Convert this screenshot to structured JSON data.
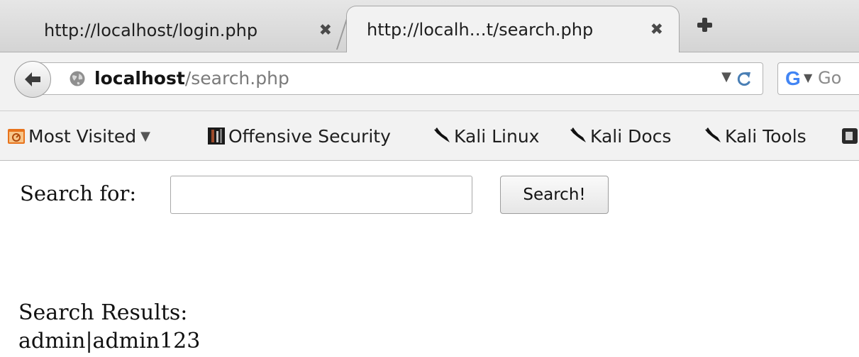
{
  "tabs": [
    {
      "title": "http://localhost/login.php",
      "close": "✖",
      "active": false
    },
    {
      "title": "http://localh…t/search.php",
      "close": "✖",
      "active": true
    }
  ],
  "navbar": {
    "url_host": "localhost",
    "url_path": "/search.php",
    "url_dropdown": "▼",
    "search_engine_letter": "G",
    "search_engine_dropdown": "▼",
    "search_placeholder": "Go"
  },
  "bookmarks": [
    {
      "label": "Most Visited",
      "caret": "▼",
      "icon": "most-visited-folder-icon"
    },
    {
      "label": "Offensive Security",
      "icon": "offensive-security-icon"
    },
    {
      "label": "Kali Linux",
      "icon": "kali-dragon-icon"
    },
    {
      "label": "Kali Docs",
      "icon": "kali-dragon-icon"
    },
    {
      "label": "Kali Tools",
      "icon": "kali-dragon-icon"
    }
  ],
  "page": {
    "search_label": "Search for:",
    "search_value": "",
    "search_button": "Search!",
    "results_title": "Search Results:",
    "results": [
      "admin|admin123"
    ]
  },
  "colors": {
    "chrome_bg": "#f2f2f2",
    "tabstrip_bg": "#dcdcdc",
    "google_blue": "#4285f4",
    "folder_orange": "#e8731c"
  }
}
